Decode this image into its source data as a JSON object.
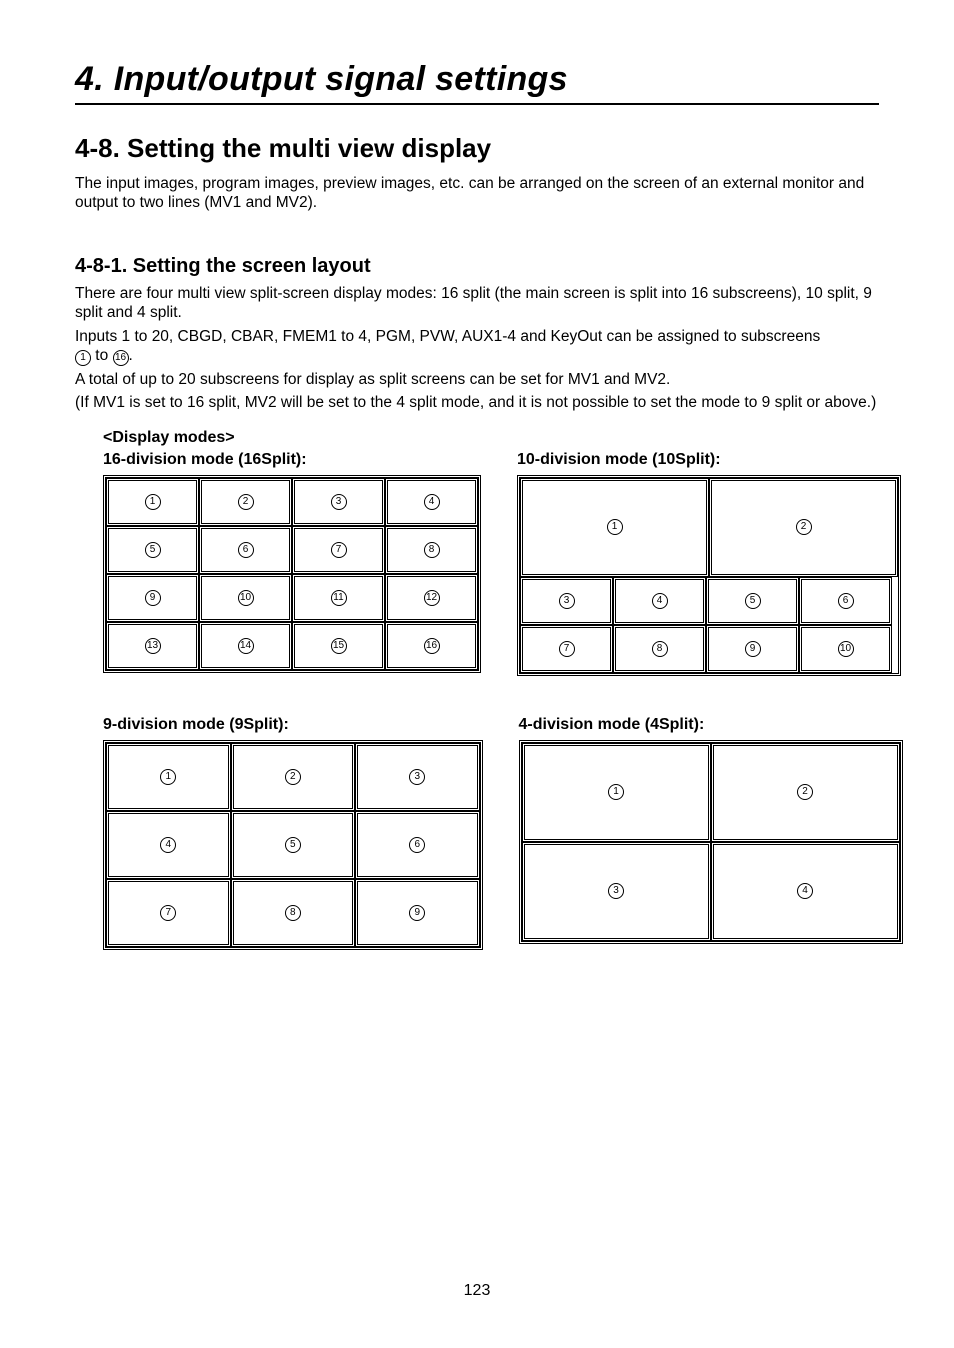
{
  "chapter": {
    "title": "4. Input/output signal settings"
  },
  "section": {
    "title": "4-8. Setting the multi view display",
    "para": "The input images, program images, preview images, etc. can be arranged on the screen of an external monitor and output to two lines (MV1 and MV2)."
  },
  "subsection": {
    "title": "4-8-1. Setting the screen layout",
    "paras": [
      "There are four multi view split-screen display modes: 16 split (the main screen is split into 16 subscreens), 10 split, 9 split and 4 split.",
      "Inputs 1 to 20, CBGD, CBAR, FMEM1 to 4, PGM, PVW, AUX1-4 and KeyOut can be assigned to subscreens",
      " to ",
      ".",
      "A total of up to 20 subscreens for display as split screens can be set for MV1 and MV2.",
      "(If MV1 is set to 16 split, MV2 will be set to the 4 split mode, and it is not possible to set the mode to 9 split or above.)"
    ],
    "subscreen_from": "1",
    "subscreen_to": "16"
  },
  "modes": {
    "heading": "<Display modes>",
    "split16": {
      "label": "16-division mode (16Split):",
      "cells": [
        "1",
        "2",
        "3",
        "4",
        "5",
        "6",
        "7",
        "8",
        "9",
        "10",
        "11",
        "12",
        "13",
        "14",
        "15",
        "16"
      ]
    },
    "split10": {
      "label": "10-division mode (10Split):",
      "top": [
        "1",
        "2"
      ],
      "bot": [
        "3",
        "4",
        "5",
        "6",
        "7",
        "8",
        "9",
        "10"
      ]
    },
    "split9": {
      "label": "9-division mode (9Split):",
      "cells": [
        "1",
        "2",
        "3",
        "4",
        "5",
        "6",
        "7",
        "8",
        "9"
      ]
    },
    "split4": {
      "label": "4-division mode (4Split):",
      "cells": [
        "1",
        "2",
        "3",
        "4"
      ]
    }
  },
  "page_number": "123"
}
